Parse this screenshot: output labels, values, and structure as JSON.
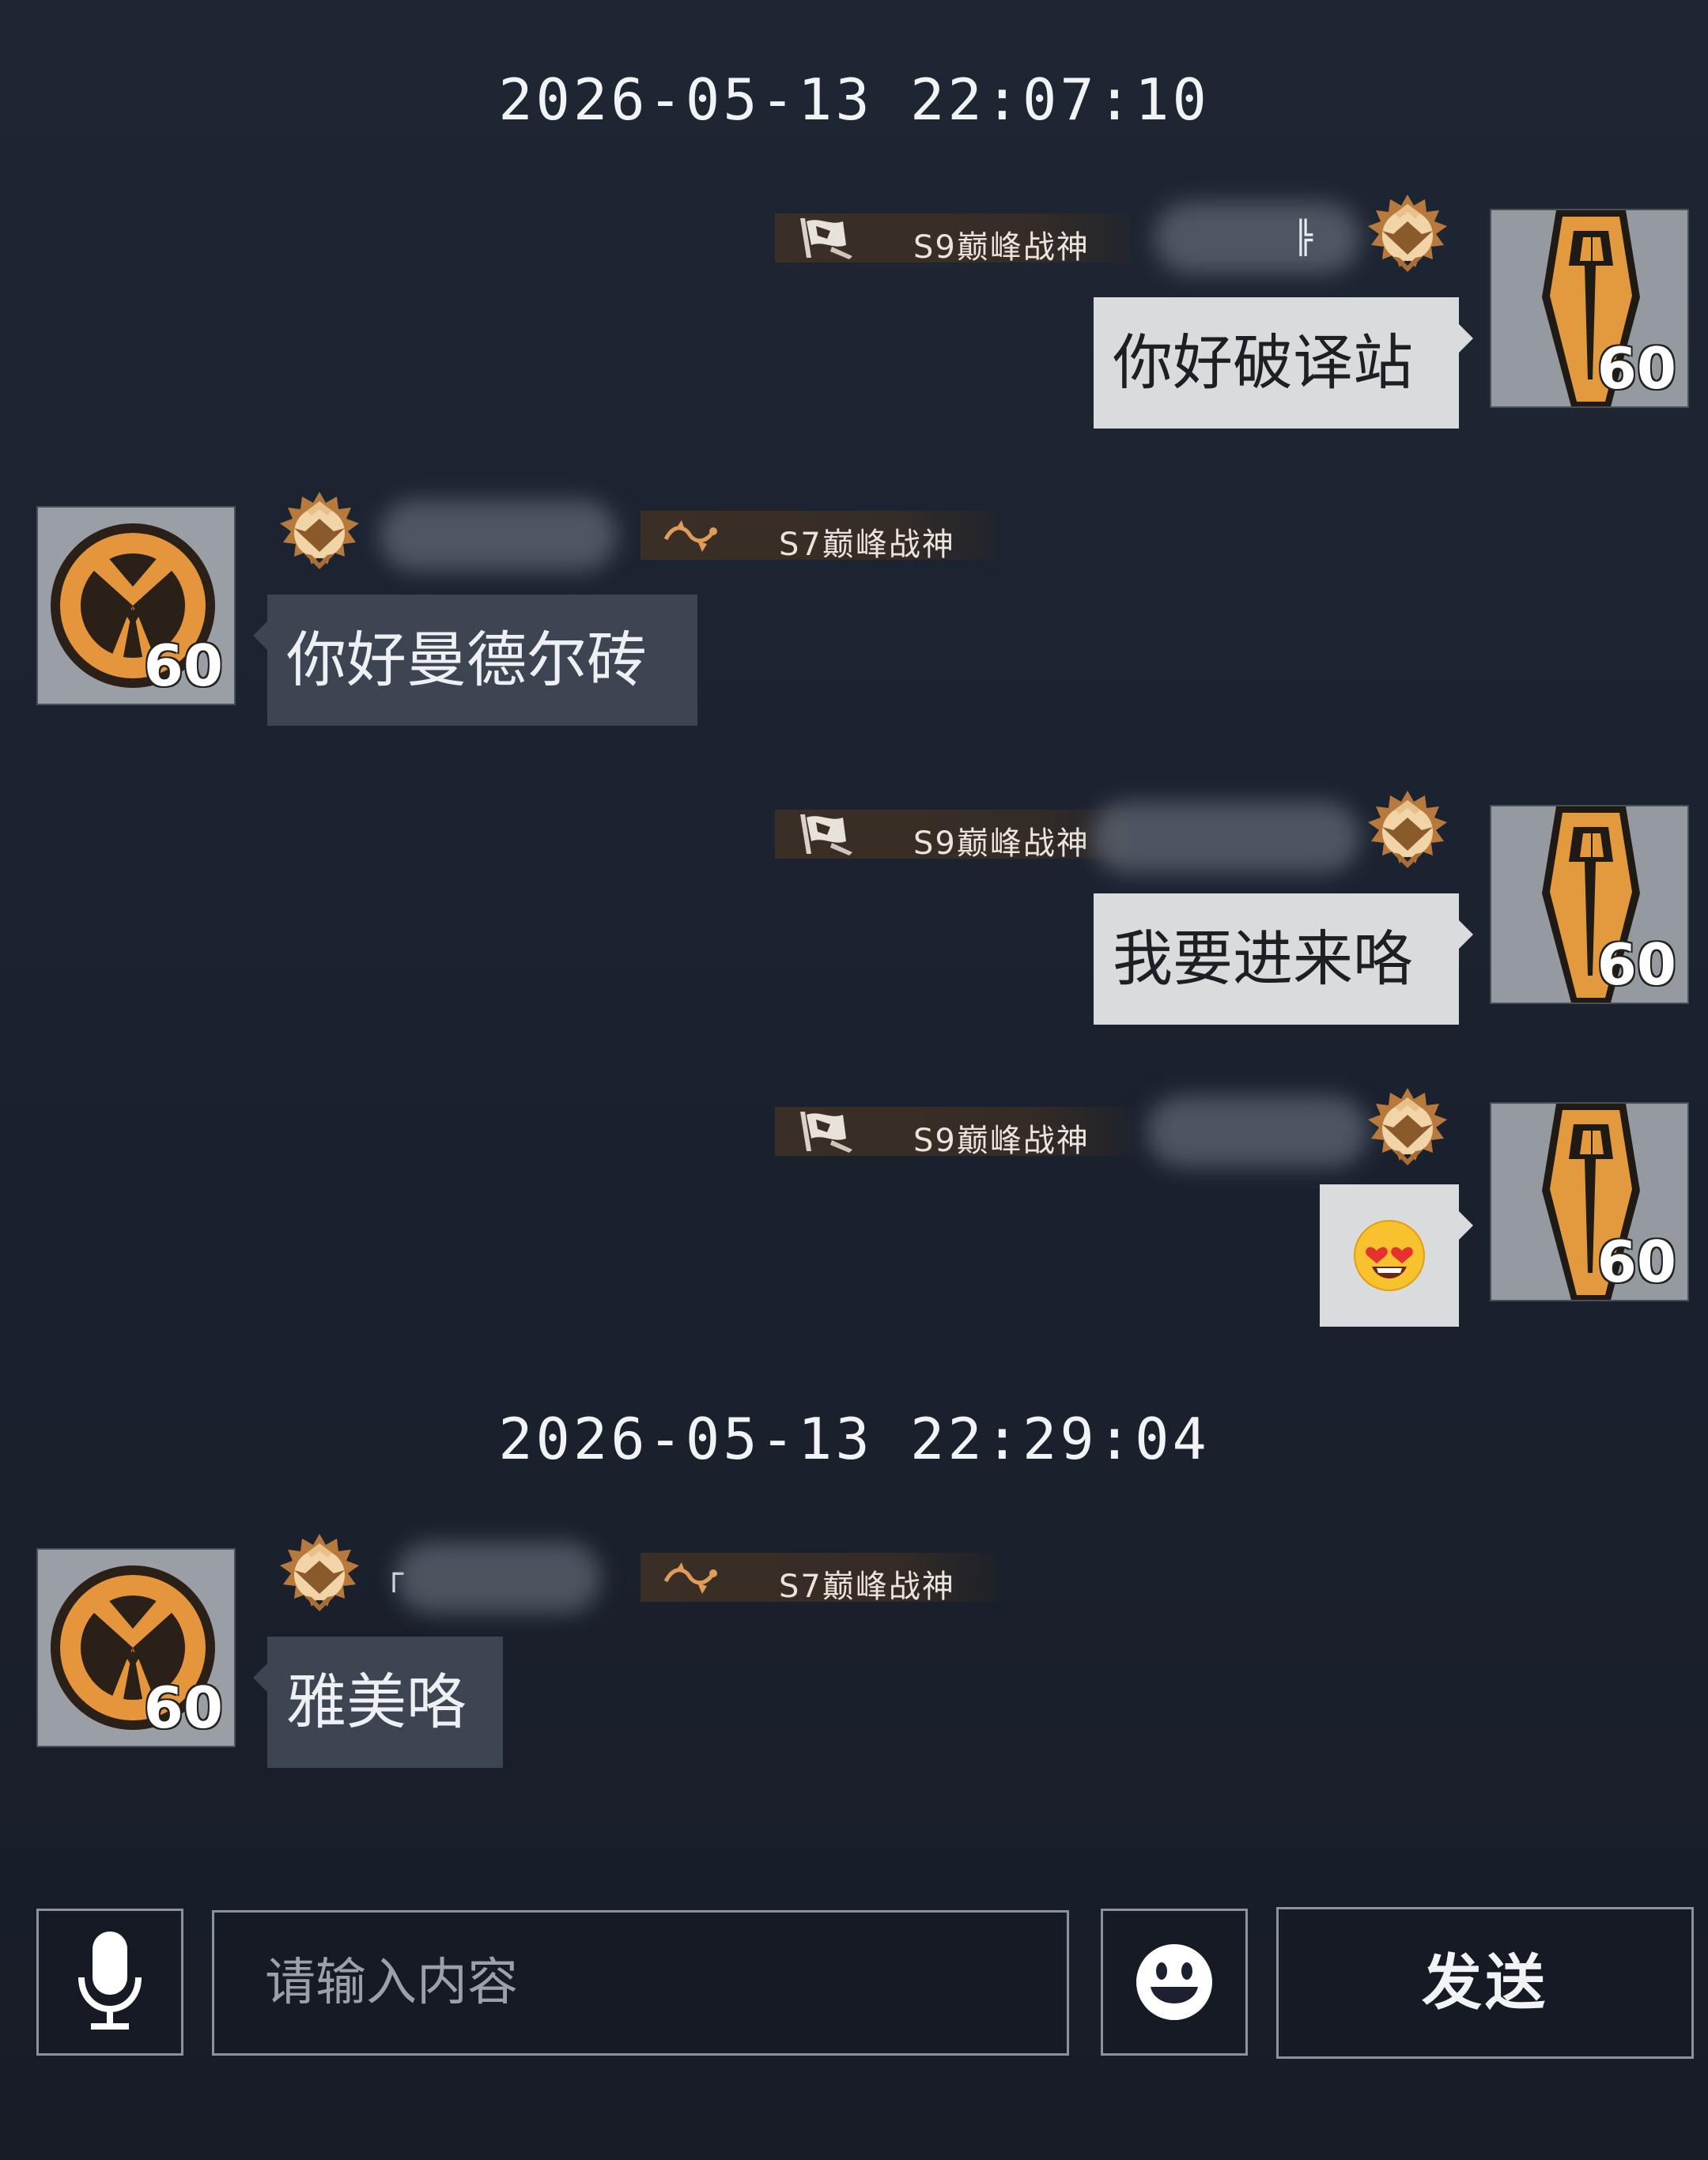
{
  "chat": {
    "timestamps": [
      "2026-05-13 22:07:10",
      "2026-05-13 22:29:04"
    ],
    "messages": [
      {
        "direction": "outgoing",
        "title": "S9巅峰战神",
        "name_fragment": "╠",
        "text": "你好破译站",
        "avatar_level": "60",
        "avatar_icon": "coffin-emblem-icon"
      },
      {
        "direction": "incoming",
        "title": "S7巅峰战神",
        "text": "你好曼德尔砖",
        "avatar_level": "60",
        "avatar_icon": "tri-blade-emblem-icon"
      },
      {
        "direction": "outgoing",
        "title": "S9巅峰战神",
        "text": "我要进来咯",
        "avatar_level": "60",
        "avatar_icon": "coffin-emblem-icon"
      },
      {
        "direction": "outgoing",
        "title": "S9巅峰战神",
        "emoji": "heart-eyes-emoji-icon",
        "avatar_level": "60",
        "avatar_icon": "coffin-emblem-icon"
      },
      {
        "direction": "incoming",
        "title": "S7巅峰战神",
        "name_fragment": "┌",
        "text": "雅美咯",
        "avatar_level": "60",
        "avatar_icon": "tri-blade-emblem-icon"
      }
    ]
  },
  "input_bar": {
    "placeholder": "请输入内容",
    "send_label": "发送",
    "mic_icon": "microphone-icon",
    "emoji_icon": "smiley-icon"
  },
  "colors": {
    "background": "#1c2330",
    "outgoing_bubble": "#d9dbdd",
    "incoming_bubble": "#3d4553",
    "emblem_orange": "#e0902f",
    "badge_gold": "#d9a05a"
  }
}
